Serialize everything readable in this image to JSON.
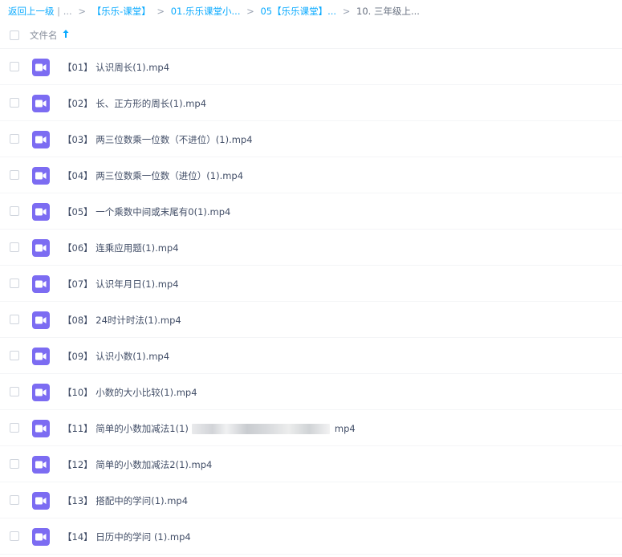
{
  "breadcrumb": {
    "back_label": "返回上一级",
    "divider": "|",
    "ellipsis": "...",
    "sep": ">",
    "crumbs": [
      "【乐乐-课堂】",
      "01.乐乐课堂小...",
      "05【乐乐课堂】..."
    ],
    "current": "10. 三年级上..."
  },
  "header": {
    "column_name": "文件名",
    "sort_icon": "arrow-up-icon"
  },
  "files": [
    {
      "name": "【01】 认识周长(1).mp4",
      "icon": "video-file-icon"
    },
    {
      "name": "【02】 长、正方形的周长(1).mp4",
      "icon": "video-file-icon"
    },
    {
      "name": "【03】 两三位数乘一位数（不进位）(1).mp4",
      "icon": "video-file-icon"
    },
    {
      "name": "【04】 两三位数乘一位数（进位）(1).mp4",
      "icon": "video-file-icon"
    },
    {
      "name": "【05】 一个乘数中间或末尾有0(1).mp4",
      "icon": "video-file-icon"
    },
    {
      "name": "【06】 连乘应用题(1).mp4",
      "icon": "video-file-icon"
    },
    {
      "name": "【07】 认识年月日(1).mp4",
      "icon": "video-file-icon"
    },
    {
      "name": "【08】 24时计时法(1).mp4",
      "icon": "video-file-icon"
    },
    {
      "name": "【09】 认识小数(1).mp4",
      "icon": "video-file-icon"
    },
    {
      "name": "【10】 小数的大小比较(1).mp4",
      "icon": "video-file-icon"
    },
    {
      "name_prefix": "【11】 简单的小数加减法1(1)",
      "name_suffix": "mp4",
      "icon": "video-file-icon"
    },
    {
      "name": "【12】 简单的小数加减法2(1).mp4",
      "icon": "video-file-icon"
    },
    {
      "name": "【13】 搭配中的学问(1).mp4",
      "icon": "video-file-icon"
    },
    {
      "name": "【14】 日历中的学问 (1).mp4",
      "icon": "video-file-icon"
    }
  ],
  "colors": {
    "accent": "#09aaff",
    "video_icon": "#7c6cf2"
  }
}
